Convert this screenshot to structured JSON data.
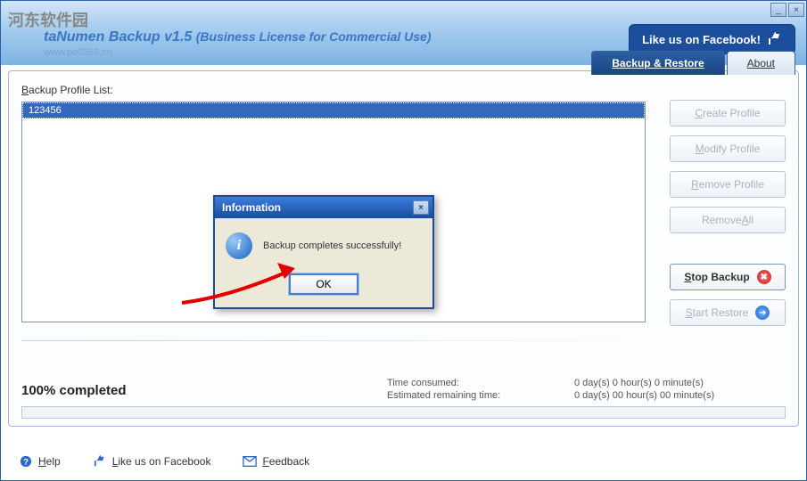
{
  "watermark": "河东软件园",
  "wm_url": "www.pc0359.cn",
  "header": {
    "title_main": "taNumen Backup",
    "title_version": "v1.5",
    "title_sub": "(Business License for Commercial Use)",
    "facebook_btn": "Like us on Facebook!"
  },
  "tabs": {
    "backup_restore": "Backup & Restore",
    "about": "About"
  },
  "section": {
    "profile_list_label": "Backup Profile List:"
  },
  "profiles": [
    "123456"
  ],
  "buttons": {
    "create": "Create Profile",
    "modify": "Modify Profile",
    "remove": "Remove Profile",
    "remove_all": "Remove All",
    "stop": "Stop Backup",
    "start_restore": "Start Restore"
  },
  "progress": {
    "percent_label": "100% completed",
    "time_consumed_label": "Time consumed:",
    "time_consumed_value": "0 day(s) 0 hour(s) 0 minute(s)",
    "est_label": "Estimated remaining time:",
    "est_value": "0 day(s) 00 hour(s) 00 minute(s)"
  },
  "footer": {
    "help": "Help",
    "like": "Like us on Facebook",
    "feedback": "Feedback"
  },
  "dialog": {
    "title": "Information",
    "message": "Backup completes successfully!",
    "ok": "OK"
  },
  "icons": {
    "minimize": "_",
    "close": "×",
    "info": "i",
    "stop": "✖",
    "arrow": "➔"
  }
}
